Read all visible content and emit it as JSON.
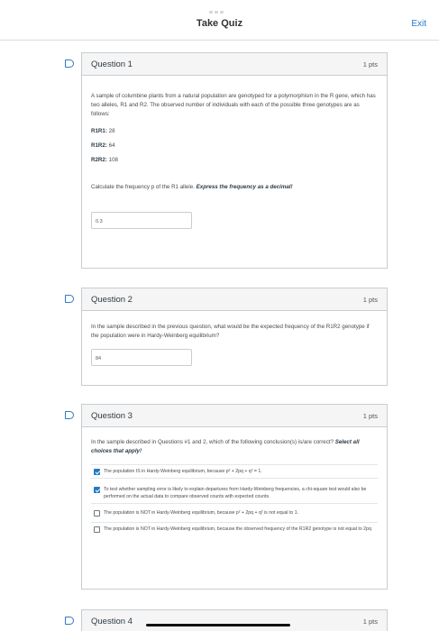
{
  "header": {
    "title": "Take Quiz",
    "exit_label": "Exit"
  },
  "q1": {
    "title": "Question 1",
    "points": "1 pts",
    "intro": "A sample of columbine plants from a natural population are genotyped for a polymorphism in the R gene, which has two alleles, R1 and R2. The observed number of individuals with each of the possible three genotypes are as follows:",
    "genotypes": [
      {
        "label": "R1R1:",
        "value": "28"
      },
      {
        "label": "R1R2:",
        "value": "64"
      },
      {
        "label": "R2R2:",
        "value": "108"
      }
    ],
    "prompt": "Calculate the frequency p of the R1 allele.",
    "prompt_emph": "Express the frequency as a decimal!",
    "answer": "0.3"
  },
  "q2": {
    "title": "Question 2",
    "points": "1 pts",
    "text": "In the sample described in the previous question, what would be the expected frequency of the R1R2 genotype if the population were in Hardy-Weinberg equilibrium?",
    "answer": "84"
  },
  "q3": {
    "title": "Question 3",
    "points": "1 pts",
    "text": "In the sample described in Questions #1 and 2, which of the following conclusion(s) is/are correct?",
    "text_emph": "Select all choices that apply!",
    "options": [
      {
        "text": "The population IS in Hardy-Weinberg equilibrium, because p² + 2pq + q² = 1.",
        "checked": true
      },
      {
        "text": "To test whether sampling error is likely to explain departures from Hardy-Weinberg frequencies, a chi-square test would also be performed on the actual data to compare observed counts with expected counts.",
        "checked": true
      },
      {
        "text": "The population is NOT in Hardy-Weinberg equilibrium, because p² + 2pq + q² is not equal to 1.",
        "checked": false
      },
      {
        "text": "The population is NOT in Hardy-Weinberg equilibrium, because the observed frequency of the R1R2 genotype is not equal to 2pq",
        "checked": false
      }
    ]
  },
  "q4": {
    "title": "Question 4",
    "points": "1 pts"
  },
  "colors": {
    "accent": "#2478c7",
    "border": "#c7cdd1",
    "header_bg": "#f5f5f5"
  }
}
